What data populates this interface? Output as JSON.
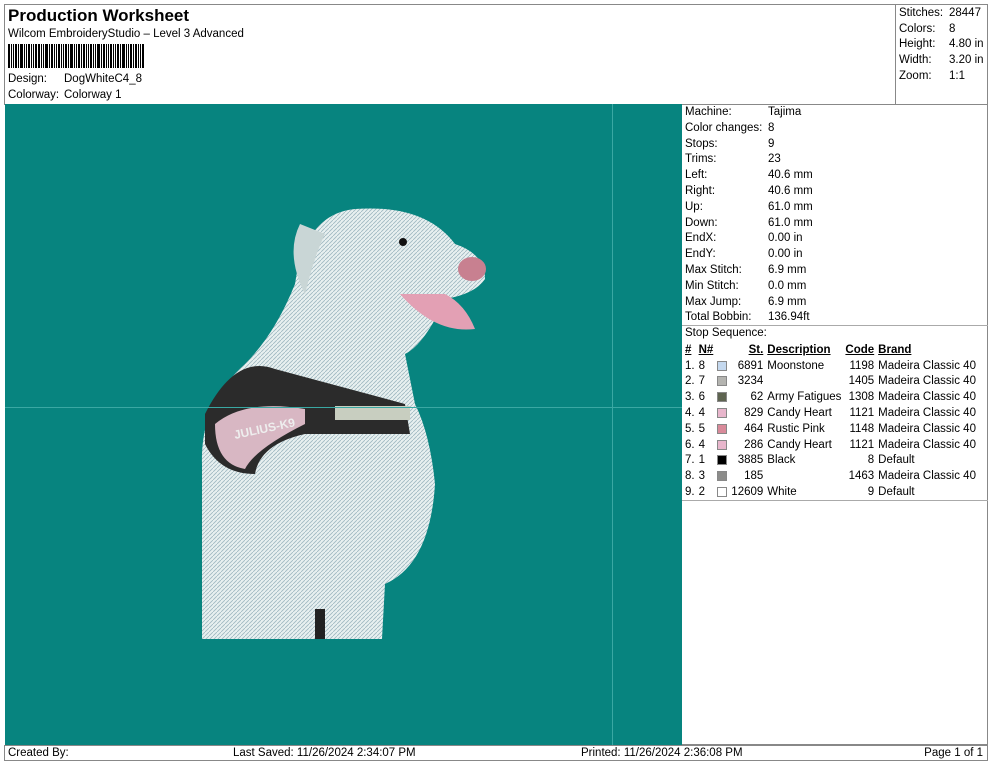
{
  "header": {
    "title": "Production Worksheet",
    "subtitle": "Wilcom EmbroideryStudio – Level 3 Advanced",
    "design_label": "Design:",
    "design": "DogWhiteC4_8",
    "colorway_label": "Colorway:",
    "colorway": "Colorway 1"
  },
  "summary": [
    {
      "k": "Stitches:",
      "v": "28447"
    },
    {
      "k": "Colors:",
      "v": "8"
    },
    {
      "k": "Height:",
      "v": "4.80 in"
    },
    {
      "k": "Width:",
      "v": "3.20 in"
    },
    {
      "k": "Zoom:",
      "v": "1:1"
    }
  ],
  "info": [
    {
      "k": "Machine:",
      "v": "Tajima"
    },
    {
      "k": "Color changes:",
      "v": "8"
    },
    {
      "k": "Stops:",
      "v": "9"
    },
    {
      "k": "Trims:",
      "v": "23"
    },
    {
      "k": "Left:",
      "v": "40.6 mm"
    },
    {
      "k": "Right:",
      "v": "40.6 mm"
    },
    {
      "k": "Up:",
      "v": "61.0 mm"
    },
    {
      "k": "Down:",
      "v": "61.0 mm"
    },
    {
      "k": "EndX:",
      "v": "0.00 in"
    },
    {
      "k": "EndY:",
      "v": "0.00 in"
    },
    {
      "k": "Max Stitch:",
      "v": "6.9 mm"
    },
    {
      "k": "Min Stitch:",
      "v": "0.0 mm"
    },
    {
      "k": "Max Jump:",
      "v": "6.9 mm"
    },
    {
      "k": "Total Bobbin:",
      "v": "136.94ft"
    }
  ],
  "stop_sequence_label": "Stop Sequence:",
  "columns": {
    "num": "#",
    "n": "N#",
    "st": "St.",
    "desc": "Description",
    "code": "Code",
    "brand": "Brand"
  },
  "rows": [
    {
      "num": "1.",
      "n": "8",
      "color": "#c4d8ee",
      "st": "6891",
      "desc": "Moonstone",
      "code": "1198",
      "brand": "Madeira Classic 40"
    },
    {
      "num": "2.",
      "n": "7",
      "color": "#b4b4b0",
      "st": "3234",
      "desc": "",
      "code": "1405",
      "brand": "Madeira Classic 40"
    },
    {
      "num": "3.",
      "n": "6",
      "color": "#5e6450",
      "st": "62",
      "desc": "Army Fatigues",
      "code": "1308",
      "brand": "Madeira Classic 40"
    },
    {
      "num": "4.",
      "n": "4",
      "color": "#e8b6cc",
      "st": "829",
      "desc": "Candy Heart",
      "code": "1121",
      "brand": "Madeira Classic 40"
    },
    {
      "num": "5.",
      "n": "5",
      "color": "#d98a9a",
      "st": "464",
      "desc": "Rustic Pink",
      "code": "1148",
      "brand": "Madeira Classic 40"
    },
    {
      "num": "6.",
      "n": "4",
      "color": "#e8b6cc",
      "st": "286",
      "desc": "Candy Heart",
      "code": "1121",
      "brand": "Madeira Classic 40"
    },
    {
      "num": "7.",
      "n": "1",
      "color": "#000000",
      "st": "3885",
      "desc": "Black",
      "code": "8",
      "brand": "Default"
    },
    {
      "num": "8.",
      "n": "3",
      "color": "#8c8c8a",
      "st": "185",
      "desc": "",
      "code": "1463",
      "brand": "Madeira Classic 40"
    },
    {
      "num": "9.",
      "n": "2",
      "color": "#ffffff",
      "st": "12609",
      "desc": "White",
      "code": "9",
      "brand": "Default"
    }
  ],
  "design_image": {
    "harness_text": "JULIUS-K9"
  },
  "footer": {
    "created": "Created By:",
    "saved": "Last Saved: 11/26/2024 2:34:07 PM",
    "printed": "Printed: 11/26/2024 2:36:08 PM",
    "page": "Page 1 of 1"
  },
  "colors": {
    "background": "#07847f"
  }
}
